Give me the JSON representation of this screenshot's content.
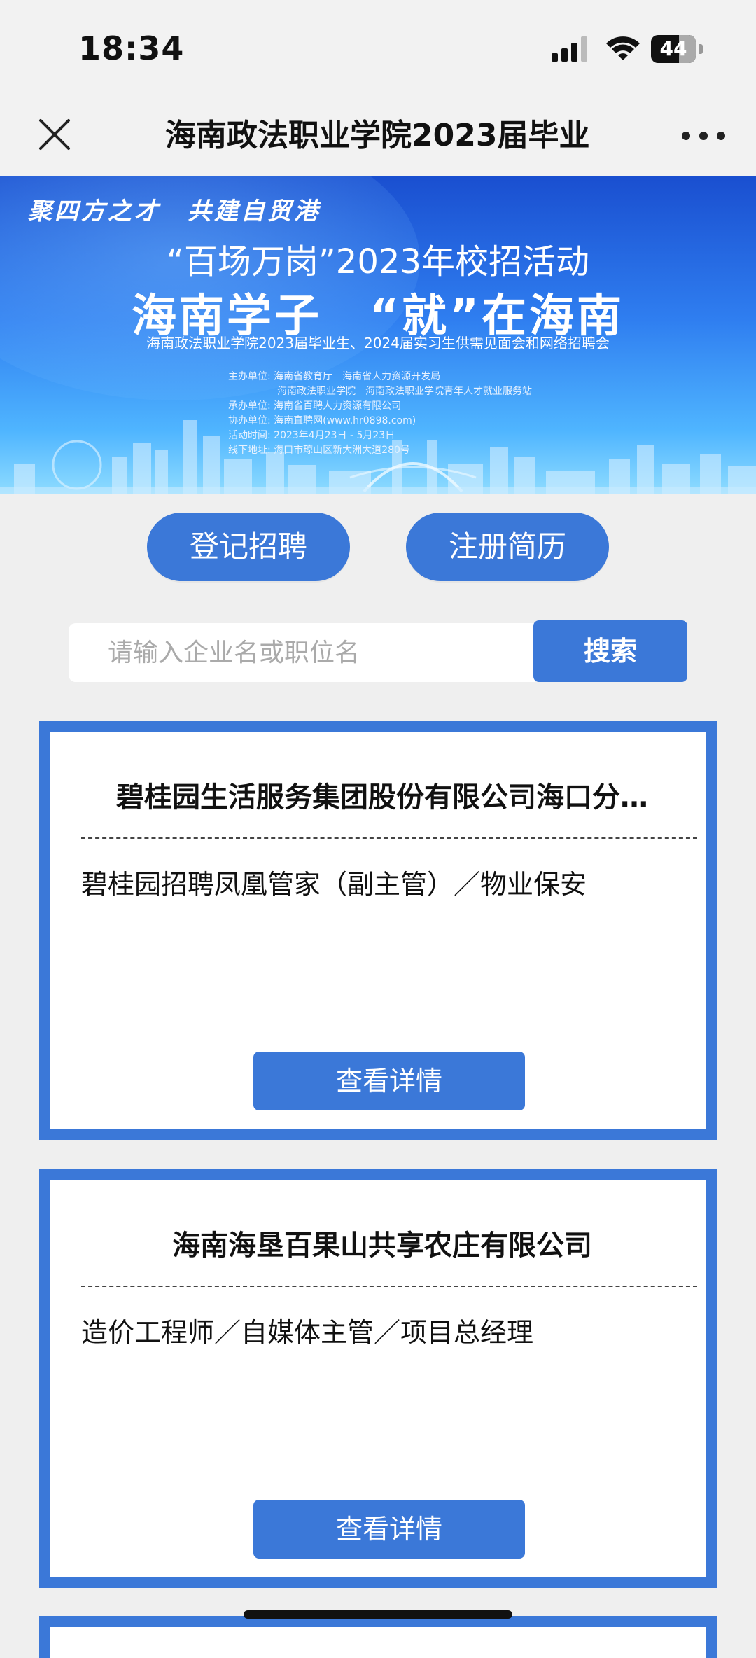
{
  "status_bar": {
    "time": "18:34",
    "battery": "44"
  },
  "navbar": {
    "title": "海南政法职业学院2023届毕业"
  },
  "banner": {
    "slogan": "聚四方之才　共建自贸港",
    "subtitle": "“百场万岗”2023年校招活动",
    "main_title": "海南学子　“就”在海南",
    "event_line": "海南政法职业学院2023届毕业生、2024届实习生供需见面会和网络招聘会",
    "info_lines": [
      "主办单位: 海南省教育厅　海南省人力资源开发局",
      "　　　　　海南政法职业学院　海南政法职业学院青年人才就业服务站",
      "承办单位: 海南省百聘人力资源有限公司",
      "协办单位: 海南直聘网(www.hr0898.com)",
      "活动时间: 2023年4月23日 - 5月23日",
      "线下地址: 海口市琼山区新大洲大道280号"
    ]
  },
  "actions": {
    "register_recruit": "登记招聘",
    "register_resume": "注册简历"
  },
  "search": {
    "placeholder": "请输入企业名或职位名",
    "button": "搜索"
  },
  "cards": [
    {
      "company": "碧桂园生活服务集团股份有限公司海口分…",
      "jobs": "碧桂园招聘凤凰管家（副主管）／物业保安",
      "button": "查看详情"
    },
    {
      "company": "海南海垦百果山共享农庄有限公司",
      "jobs": "造价工程师／自媒体主管／项目总经理",
      "button": "查看详情"
    }
  ]
}
